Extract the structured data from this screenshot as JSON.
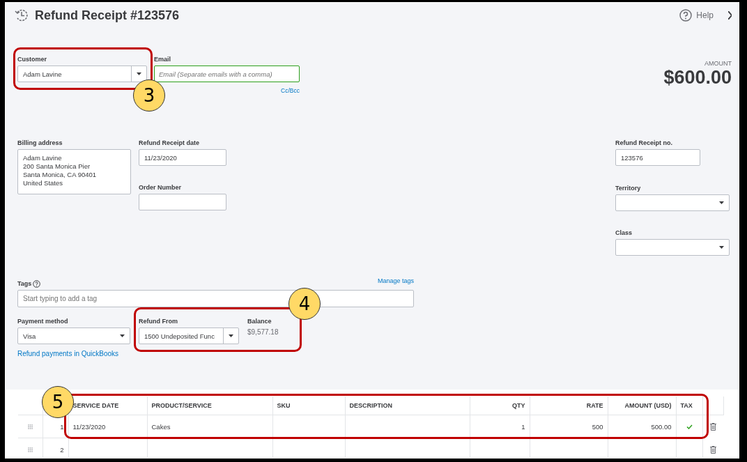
{
  "header": {
    "title": "Refund Receipt #123576",
    "help": "Help"
  },
  "customer": {
    "label": "Customer",
    "value": "Adam Lavine"
  },
  "email": {
    "label": "Email",
    "placeholder": "Email (Separate emails with a comma)",
    "link": "Cc/Bcc"
  },
  "amount": {
    "label": "AMOUNT",
    "value": "$600.00"
  },
  "billing_address": {
    "label": "Billing address",
    "lines": [
      "Adam Lavine",
      "200 Santa Monica Pier",
      "Santa Monica, CA  90401",
      "United States"
    ]
  },
  "refund_receipt_date": {
    "label": "Refund Receipt date",
    "value": "11/23/2020"
  },
  "order_number": {
    "label": "Order Number"
  },
  "refund_receipt_no": {
    "label": "Refund Receipt no.",
    "value": "123576"
  },
  "territory": {
    "label": "Territory"
  },
  "class": {
    "label": "Class"
  },
  "tags": {
    "label": "Tags",
    "link": "Manage tags",
    "placeholder": "Start typing to add a tag"
  },
  "payment_method": {
    "label": "Payment method",
    "value": "Visa"
  },
  "refund_from": {
    "label": "Refund From",
    "value": "1500 Undeposited Func"
  },
  "balance": {
    "label": "Balance",
    "value": "$9,577.18"
  },
  "refund_link": "Refund payments in QuickBooks",
  "table": {
    "columns": [
      "SERVICE DATE",
      "PRODUCT/SERVICE",
      "SKU",
      "DESCRIPTION",
      "QTY",
      "RATE",
      "AMOUNT (USD)",
      "TAX"
    ],
    "rows": [
      {
        "number": "1",
        "service_date": "11/23/2020",
        "product_service": "Cakes",
        "qty": "1",
        "rate": "500",
        "amount": "500.00",
        "tax": true
      },
      {
        "number": "2",
        "tax": false
      }
    ]
  },
  "callouts": [
    {
      "number": "3"
    },
    {
      "number": "4"
    },
    {
      "number": "5"
    }
  ]
}
